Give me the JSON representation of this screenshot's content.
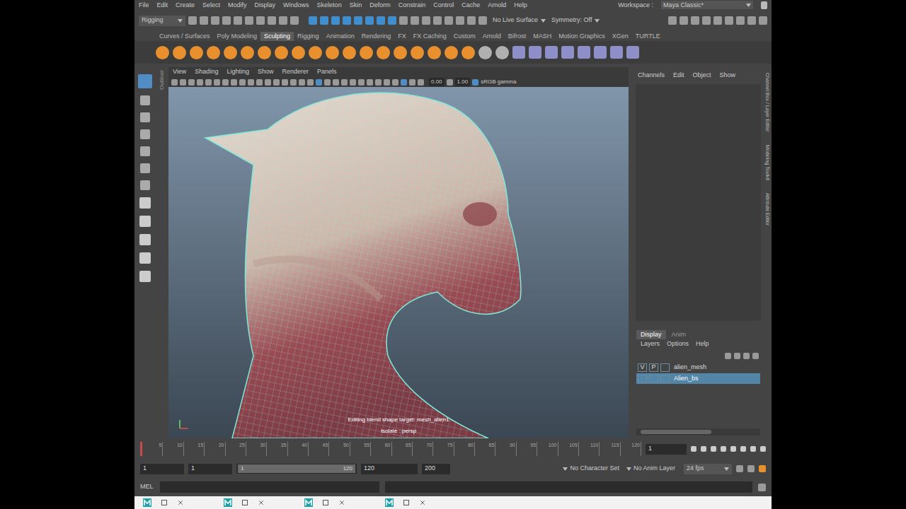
{
  "menu_bar": {
    "items": [
      "File",
      "Edit",
      "Create",
      "Select",
      "Modify",
      "Display",
      "Windows",
      "Skeleton",
      "Skin",
      "Deform",
      "Constrain",
      "Control",
      "Cache",
      "Arnold",
      "Help"
    ],
    "workspace_label": "Workspace :",
    "workspace": "Maya Classic*"
  },
  "status_line": {
    "mode": "Rigging",
    "live_surface": "No Live Surface",
    "symmetry": "Symmetry: Off"
  },
  "shelf": {
    "tabs": [
      {
        "label": "Curves / Surfaces",
        "selected": false
      },
      {
        "label": "Poly Modeling",
        "selected": false
      },
      {
        "label": "Sculpting",
        "selected": true
      },
      {
        "label": "Rigging",
        "selected": false
      },
      {
        "label": "Animation",
        "selected": false
      },
      {
        "label": "Rendering",
        "selected": false
      },
      {
        "label": "FX",
        "selected": false
      },
      {
        "label": "FX Caching",
        "selected": false
      },
      {
        "label": "Custom",
        "selected": false
      },
      {
        "label": "Arnold",
        "selected": false
      },
      {
        "label": "Bifrost",
        "selected": false
      },
      {
        "label": "MASH",
        "selected": false
      },
      {
        "label": "Motion Graphics",
        "selected": false
      },
      {
        "label": "XGen",
        "selected": false
      },
      {
        "label": "TURTLE",
        "selected": false
      }
    ]
  },
  "outliner_label": "Outliner",
  "viewport": {
    "menu": [
      "View",
      "Shading",
      "Lighting",
      "Show",
      "Renderer",
      "Panels"
    ],
    "exposure": "0.00",
    "gamma": "1.00",
    "color_space": "sRGB gamma",
    "messages": [
      "Editing blend shape target: mesh_alien1",
      "Isolate : persp"
    ]
  },
  "channel_box": {
    "menu": [
      "Channels",
      "Edit",
      "Object",
      "Show"
    ]
  },
  "layer_editor": {
    "tabs": [
      {
        "label": "Display",
        "selected": true
      },
      {
        "label": "Anim",
        "selected": false
      }
    ],
    "menu": [
      "Layers",
      "Options",
      "Help"
    ],
    "layers": [
      {
        "name": "alien_mesh",
        "visible_mark": "V",
        "playback_mark": "P",
        "selected": false
      },
      {
        "name": "Alien_bs",
        "visible_mark": "",
        "playback_mark": "",
        "selected": true
      }
    ]
  },
  "side_tabs": [
    "Channel Box / Layer Editor",
    "Modeling Toolkit",
    "Attribute Editor"
  ],
  "time_slider": {
    "ticks": [
      "5",
      "10",
      "15",
      "20",
      "25",
      "30",
      "35",
      "40",
      "45",
      "50",
      "55",
      "60",
      "65",
      "70",
      "75",
      "80",
      "85",
      "90",
      "95",
      "100",
      "105",
      "110",
      "115",
      "120"
    ],
    "current_frame": "1"
  },
  "range_slider": {
    "start": "1",
    "playback_start": "1",
    "range_start": "1",
    "range_end": "120",
    "playback_end": "120",
    "end": "200",
    "character_set": "No Character Set",
    "anim_layer": "No Anim Layer",
    "fps": "24 fps"
  },
  "command_line": {
    "language": "MEL"
  },
  "taskbar": {
    "windows": [
      {
        "selected": false
      },
      {
        "selected": false
      },
      {
        "selected": false
      },
      {
        "selected": false
      }
    ]
  }
}
